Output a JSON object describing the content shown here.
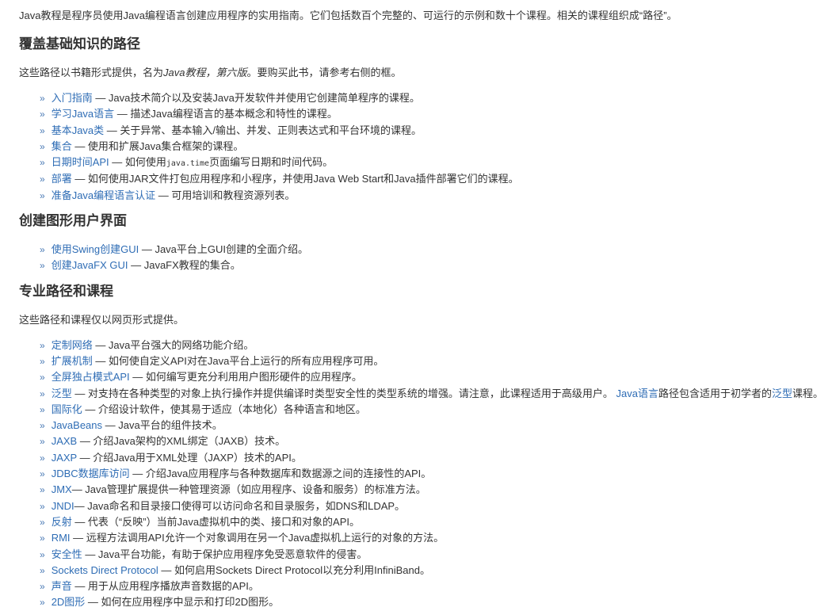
{
  "intro": "Java教程是程序员使用Java编程语言创建应用程序的实用指南。它们包括数百个完整的、可运行的示例和数十个课程。相关的课程组织成“路径”。",
  "section1": {
    "title": "覆盖基础知识的路径",
    "lead_before": "这些路径以书籍形式提供，名为",
    "lead_book": "Java教程，第六版",
    "lead_after": "。要购买此书，请参考右侧的框。",
    "items": [
      {
        "link": "入门指南",
        "desc": " — Java技术简介以及安装Java开发软件并使用它创建简单程序的课程。"
      },
      {
        "link": "学习Java语言",
        "desc": " — 描述Java编程语言的基本概念和特性的课程。"
      },
      {
        "link": "基本Java类",
        "desc": " — 关于异常、基本输入/输出、并发、正则表达式和平台环境的课程。"
      },
      {
        "link": "集合",
        "desc": " — 使用和扩展Java集合框架的课程。"
      },
      {
        "link": "日期时间API",
        "desc_before": " — 如何使用",
        "code": "java.time",
        "desc_after": "页面编写日期和时间代码。"
      },
      {
        "link": "部署",
        "desc": " — 如何使用JAR文件打包应用程序和小程序，并使用Java Web Start和Java插件部署它们的课程。"
      },
      {
        "link": "准备Java编程语言认证",
        "desc": " — 可用培训和教程资源列表。"
      }
    ]
  },
  "section2": {
    "title": "创建图形用户界面",
    "items": [
      {
        "link": "使用Swing创建GUI",
        "desc": " — Java平台上GUI创建的全面介绍。"
      },
      {
        "link": "创建JavaFX GUI",
        "desc": " — JavaFX教程的集合。"
      }
    ]
  },
  "section3": {
    "title": "专业路径和课程",
    "lead": "这些路径和课程仅以网页形式提供。",
    "items": [
      {
        "link": "定制网络",
        "desc": " — Java平台强大的网络功能介绍。"
      },
      {
        "link": "扩展机制",
        "desc": " — 如何使自定义API对在Java平台上运行的所有应用程序可用。"
      },
      {
        "link": "全屏独占模式API",
        "desc": " — 如何编写更充分利用用户图形硬件的应用程序。"
      },
      {
        "link": "泛型",
        "desc": " — 对支持在各种类型的对象上执行操作并提供编译时类型安全性的类型系统的增强。请注意，此课程适用于高级用户。 ",
        "link2": "Java语言",
        "desc2": "路径包含适用于初学者的",
        "link3": "泛型",
        "desc3": "课程。"
      },
      {
        "link": "国际化",
        "desc": " — 介绍设计软件，使其易于适应（本地化）各种语言和地区。"
      },
      {
        "link": "JavaBeans",
        "desc": " — Java平台的组件技术。"
      },
      {
        "link": "JAXB",
        "desc": " — 介绍Java架构的XML绑定（JAXB）技术。"
      },
      {
        "link": "JAXP",
        "desc": " — 介绍Java用于XML处理（JAXP）技术的API。"
      },
      {
        "link": "JDBC数据库访问",
        "desc": " — 介绍Java应用程序与各种数据库和数据源之间的连接性的API。"
      },
      {
        "link": "JMX",
        "desc": "— Java管理扩展提供一种管理资源（如应用程序、设备和服务）的标准方法。"
      },
      {
        "link": "JNDI",
        "desc": "— Java命名和目录接口使得可以访问命名和目录服务，如DNS和LDAP。"
      },
      {
        "link": "反射",
        "desc": " — 代表（“反映”）当前Java虚拟机中的类、接口和对象的API。"
      },
      {
        "link": "RMI",
        "desc": " — 远程方法调用API允许一个对象调用在另一个Java虚拟机上运行的对象的方法。"
      },
      {
        "link": "安全性",
        "desc": " — Java平台功能，有助于保护应用程序免受恶意软件的侵害。"
      },
      {
        "link": "Sockets Direct Protocol",
        "desc": " — 如何启用Sockets Direct Protocol以充分利用InfiniBand。"
      },
      {
        "link": "声音",
        "desc": " — 用于从应用程序播放声音数据的API。"
      },
      {
        "link": "2D图形",
        "desc": " — 如何在应用程序中显示和打印2D图形。"
      }
    ]
  },
  "bullet_glyph": "»"
}
